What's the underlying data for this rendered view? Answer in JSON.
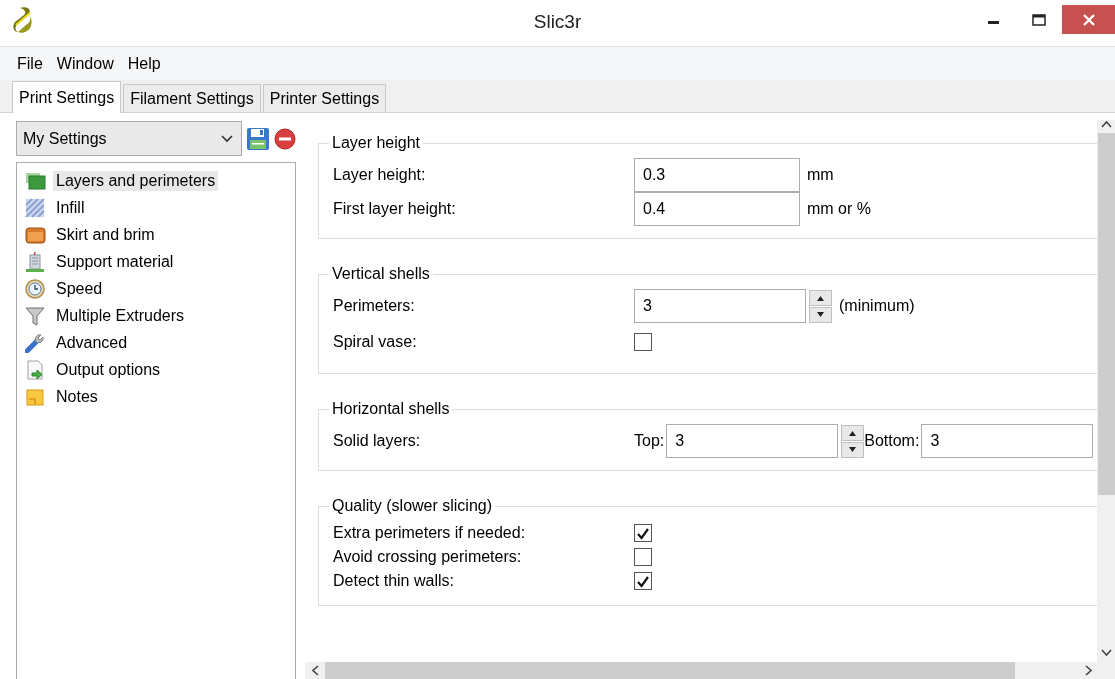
{
  "window": {
    "title": "Slic3r"
  },
  "menu": [
    "File",
    "Window",
    "Help"
  ],
  "tabs": [
    {
      "label": "Print Settings",
      "selected": true
    },
    {
      "label": "Filament Settings",
      "selected": false
    },
    {
      "label": "Printer Settings",
      "selected": false
    }
  ],
  "preset": {
    "value": "My Settings"
  },
  "pages": [
    {
      "label": "Layers and perimeters",
      "kind": "layers",
      "selected": true
    },
    {
      "label": "Infill",
      "kind": "infill",
      "selected": false
    },
    {
      "label": "Skirt and brim",
      "kind": "skirt",
      "selected": false
    },
    {
      "label": "Support material",
      "kind": "support",
      "selected": false
    },
    {
      "label": "Speed",
      "kind": "speed",
      "selected": false
    },
    {
      "label": "Multiple Extruders",
      "kind": "extruders",
      "selected": false
    },
    {
      "label": "Advanced",
      "kind": "advanced",
      "selected": false
    },
    {
      "label": "Output options",
      "kind": "output",
      "selected": false
    },
    {
      "label": "Notes",
      "kind": "notes",
      "selected": false
    }
  ],
  "groups": [
    {
      "title": "Layer height",
      "rows": [
        {
          "kind": "text",
          "label": "Layer height:",
          "value": "0.3",
          "unit": "mm"
        },
        {
          "kind": "text",
          "label": "First layer height:",
          "value": "0.4",
          "unit": "mm or %"
        }
      ]
    },
    {
      "title": "Vertical shells",
      "rows": [
        {
          "kind": "spin",
          "label": "Perimeters:",
          "value": "3",
          "unit": "(minimum)"
        },
        {
          "kind": "checkbox",
          "label": "Spiral vase:",
          "checked": false
        }
      ]
    },
    {
      "title": "Horizontal shells",
      "rows": [
        {
          "kind": "pair",
          "label": "Solid layers:",
          "first_label": "Top:",
          "first_value": "3",
          "second_label": "Bottom:",
          "second_value": "3"
        }
      ]
    },
    {
      "title": "Quality (slower slicing)",
      "rows": [
        {
          "kind": "checkbox",
          "label": "Extra perimeters if needed:",
          "checked": true
        },
        {
          "kind": "checkbox",
          "label": "Avoid crossing perimeters:",
          "checked": false
        },
        {
          "kind": "checkbox",
          "label": "Detect thin walls:",
          "checked": true
        }
      ]
    }
  ]
}
